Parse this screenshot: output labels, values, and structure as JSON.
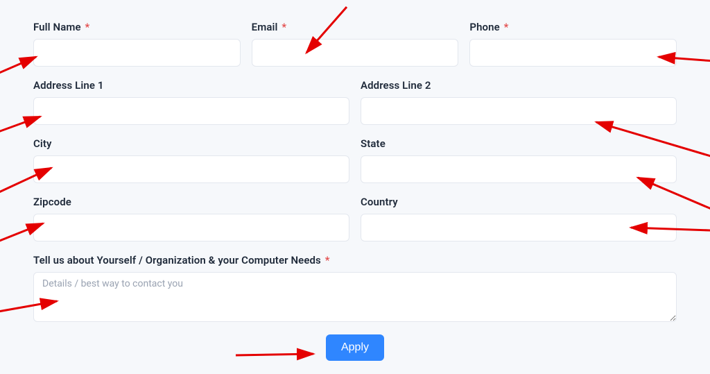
{
  "form": {
    "full_name": {
      "label": "Full Name",
      "required": true,
      "value": ""
    },
    "email": {
      "label": "Email",
      "required": true,
      "value": ""
    },
    "phone": {
      "label": "Phone",
      "required": true,
      "value": ""
    },
    "address1": {
      "label": "Address Line 1",
      "required": false,
      "value": ""
    },
    "address2": {
      "label": "Address Line 2",
      "required": false,
      "value": ""
    },
    "city": {
      "label": "City",
      "required": false,
      "value": ""
    },
    "state": {
      "label": "State",
      "required": false,
      "value": ""
    },
    "zipcode": {
      "label": "Zipcode",
      "required": false,
      "value": ""
    },
    "country": {
      "label": "Country",
      "required": false,
      "value": ""
    },
    "details": {
      "label": "Tell us about Yourself / Organization & your Computer Needs",
      "required": true,
      "value": "",
      "placeholder": "Details / best way to contact you"
    },
    "required_marker": "*",
    "submit_label": "Apply"
  }
}
